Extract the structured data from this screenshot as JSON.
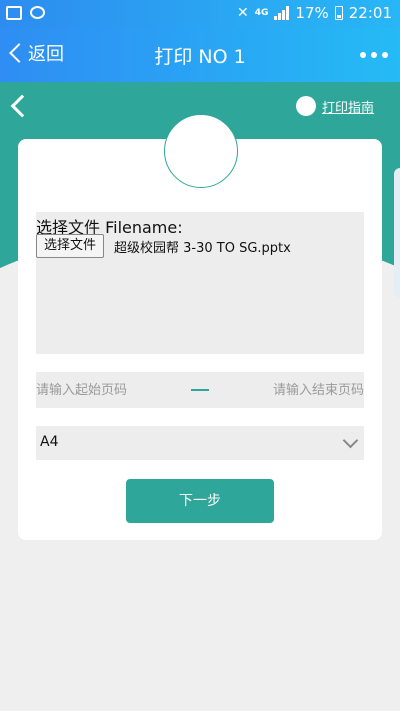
{
  "status_bar": {
    "network": "4G",
    "battery": "17%",
    "time": "22:01"
  },
  "header": {
    "back_label": "返回",
    "title": "打印 NO 1"
  },
  "guide": {
    "label": "打印指南"
  },
  "file_section": {
    "label": "选择文件 Filename:",
    "choose_button": "选择文件",
    "file_name": "超级校园帮 3-30 TO SG.pptx"
  },
  "page_range": {
    "start_placeholder": "请输入起始页码",
    "end_placeholder": "请输入结束页码"
  },
  "paper_size": {
    "selected": "A4"
  },
  "next_button": "下一步",
  "colors": {
    "header_blue": "#2d8cf0",
    "teal": "#2ea699",
    "background": "#efefef"
  }
}
